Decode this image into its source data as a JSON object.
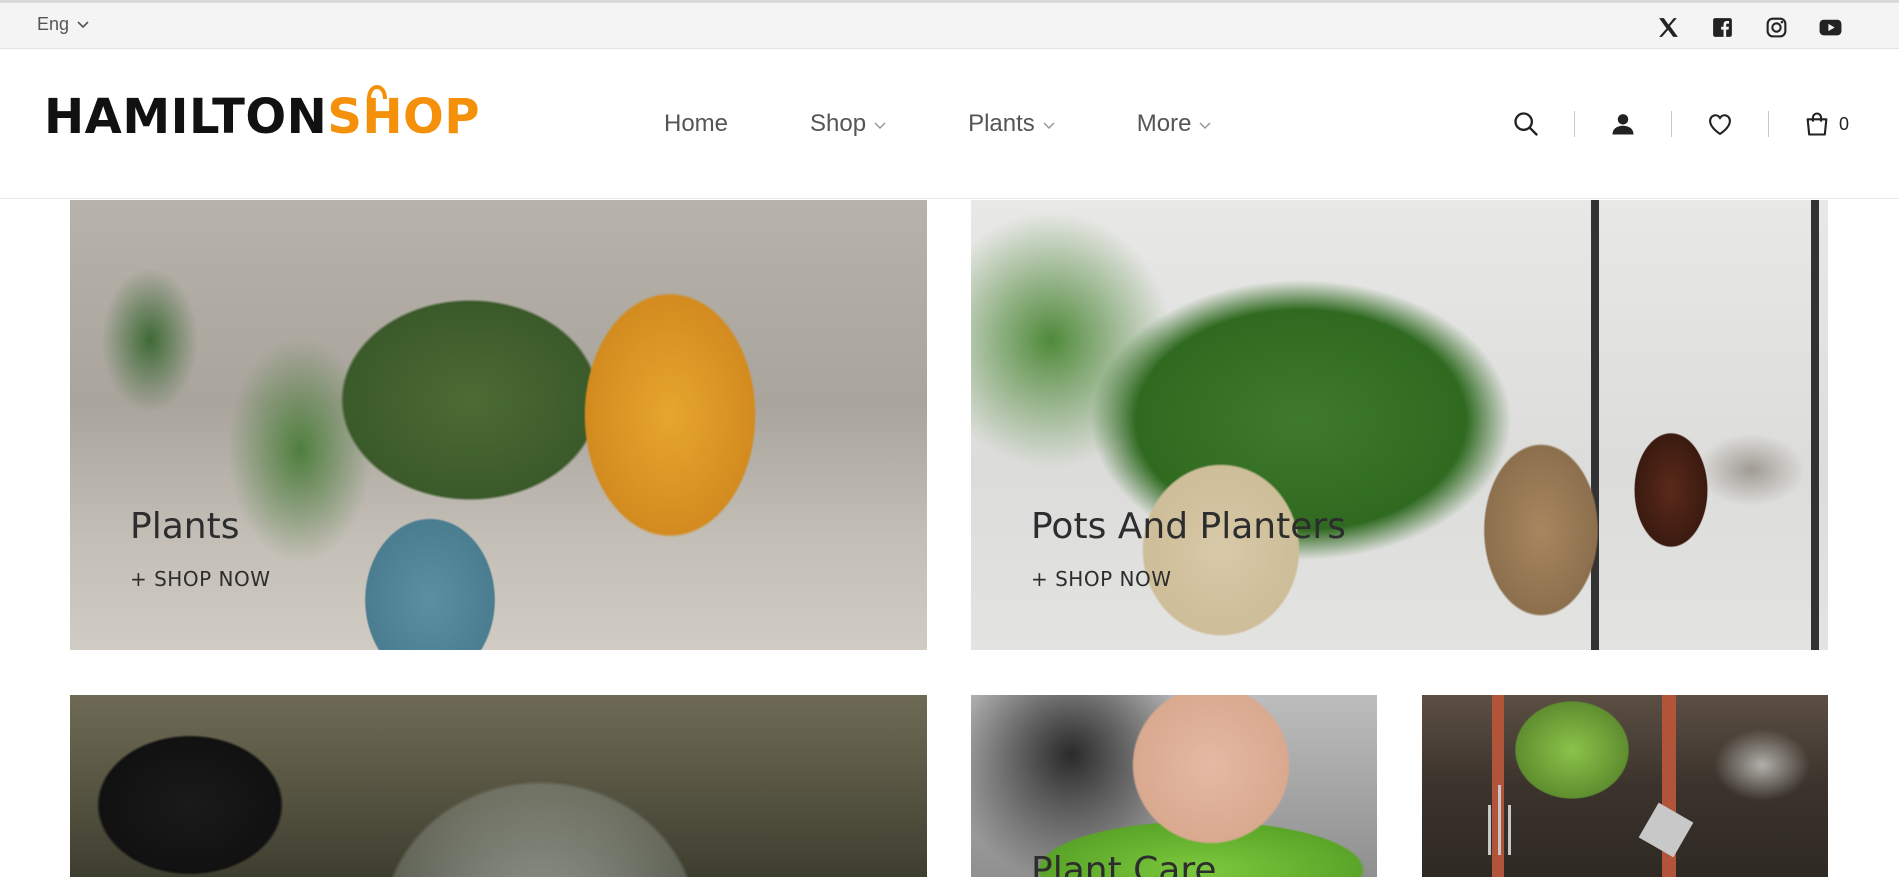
{
  "topbar": {
    "language": "Eng",
    "social_icons": [
      "x-icon",
      "facebook-icon",
      "instagram-icon",
      "youtube-icon"
    ]
  },
  "header": {
    "logo": {
      "part1": "HAMILTON",
      "part2": "SHOP",
      "accent_color": "#f5900b"
    },
    "nav": [
      {
        "label": "Home",
        "has_dropdown": false
      },
      {
        "label": "Shop",
        "has_dropdown": true
      },
      {
        "label": "Plants",
        "has_dropdown": true
      },
      {
        "label": "More",
        "has_dropdown": true
      }
    ],
    "actions": [
      "search-icon",
      "account-icon",
      "wishlist-icon",
      "cart-icon"
    ],
    "cart_count": "0"
  },
  "tiles": [
    {
      "label": "Plants",
      "cta": "+ SHOP NOW"
    },
    {
      "label": "Pots And Planters",
      "cta": "+ SHOP NOW"
    },
    {
      "label": ""
    },
    {
      "label": "Plant Care"
    },
    {
      "label": ""
    }
  ]
}
